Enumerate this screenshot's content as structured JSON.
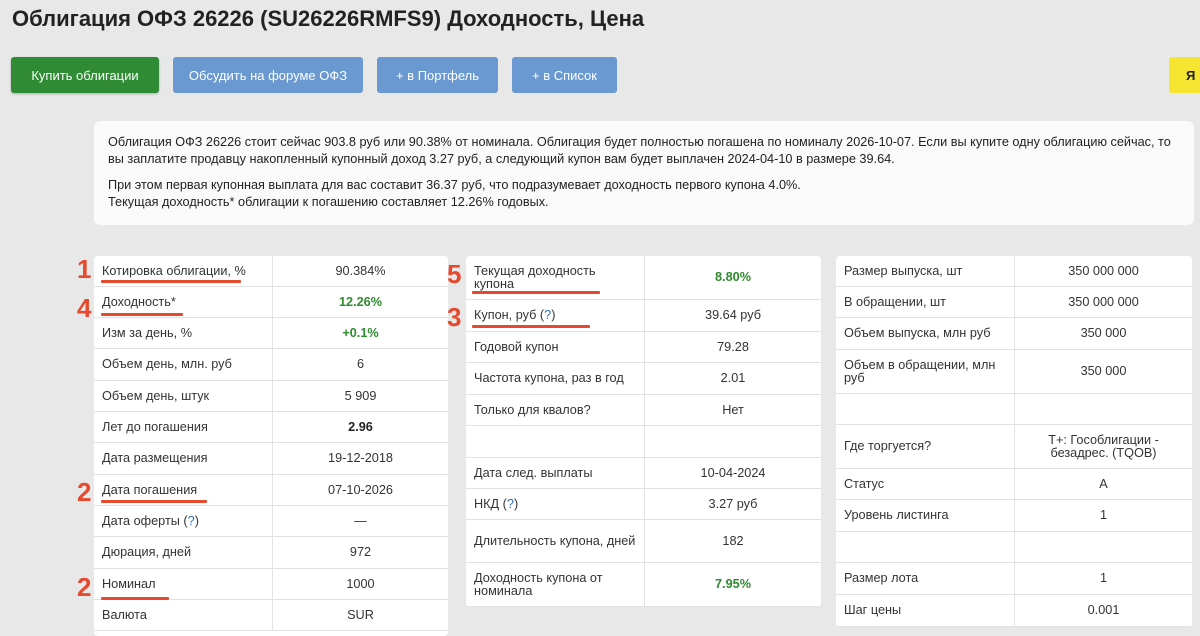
{
  "page": {
    "title": "Облигация ОФЗ 26226 (SU26226RMFS9) Доходность, Цена"
  },
  "buttons": {
    "buy": "Купить облигации",
    "forum": "Обсудить на форуме ОФЗ",
    "portfolio": "+ в Портфель",
    "list": "+ в Список",
    "yandex": "Я"
  },
  "summary": {
    "p1": "Облигация ОФЗ 26226 стоит сейчас 903.8 руб или 90.38% от номинала. Облигация будет полностью погашена по номиналу 2026-10-07. Если вы купите одну облигацию сейчас, то вы заплатите продавцу накопленный купонный доход 3.27 руб, а следующий купон вам будет выплачен 2024-04-10 в размере 39.64.",
    "p2": "При этом первая купонная выплата для вас составит 36.37 руб, что подразумевает доходность первого купона 4.0%.",
    "p3": "Текущая доходность* облигации к погашению составляет 12.26% годовых."
  },
  "table_left": [
    {
      "label": "Котировка облигации, %",
      "value": "90.384%"
    },
    {
      "label": "Доходность*",
      "value": "12.26%"
    },
    {
      "label": "Изм за день, %",
      "value": "+0.1%"
    },
    {
      "label": "Объем день, млн. руб",
      "value": "6"
    },
    {
      "label": "Объем день, штук",
      "value": "5 909"
    },
    {
      "label": "Лет до погашения",
      "value": "2.96"
    },
    {
      "label": "Дата размещения",
      "value": "19-12-2018"
    },
    {
      "label": "Дата погашения",
      "value": "07-10-2026"
    },
    {
      "label": "Дата оферты",
      "help": "?",
      "value": "—"
    },
    {
      "label": "Дюрация, дней",
      "value": "972"
    },
    {
      "label": "Номинал",
      "value": "1000"
    },
    {
      "label": "Валюта",
      "value": "SUR"
    }
  ],
  "table_middle": [
    {
      "label": "Текущая доходность купона",
      "value": "8.80%"
    },
    {
      "label": "Купон, руб",
      "help": "?",
      "value": "39.64 руб"
    },
    {
      "label": "Годовой купон",
      "value": "79.28"
    },
    {
      "label": "Частота купона, раз в год",
      "value": "2.01"
    },
    {
      "label": "Только для квалов?",
      "value": "Нет"
    },
    {
      "label": "",
      "value": ""
    },
    {
      "label": "Дата след. выплаты",
      "value": "10-04-2024"
    },
    {
      "label": "НКД",
      "help": "?",
      "value": "3.27 руб"
    },
    {
      "label": "Длительность купона, дней",
      "value": "182"
    },
    {
      "label": "Доходность купона от номинала",
      "value": "7.95%"
    }
  ],
  "table_right": [
    {
      "label": "Размер выпуска, шт",
      "value": "350 000 000"
    },
    {
      "label": "В обращении, шт",
      "value": "350 000 000"
    },
    {
      "label": "Объем выпуска, млн руб",
      "value": "350 000"
    },
    {
      "label": "Объем в обращении, млн руб",
      "value": "350 000"
    },
    {
      "label": "",
      "value": ""
    },
    {
      "label": "Где торгуется?",
      "value": "Т+: Гособлигации - безадрес. (TQOB)"
    },
    {
      "label": "Статус",
      "value": "A"
    },
    {
      "label": "Уровень листинга",
      "value": "1"
    },
    {
      "label": "",
      "value": ""
    },
    {
      "label": "Размер лота",
      "value": "1"
    },
    {
      "label": "Шаг цены",
      "value": "0.001"
    }
  ],
  "annotations": {
    "m1": "1",
    "m2a": "2",
    "m2b": "2",
    "m3": "3",
    "m4": "4",
    "m5": "5",
    "color": "#e64a2e"
  },
  "colors": {
    "buy_button": "#2f8c35",
    "secondary_button": "#6a99d2",
    "positive_value": "#2e8b2e"
  }
}
